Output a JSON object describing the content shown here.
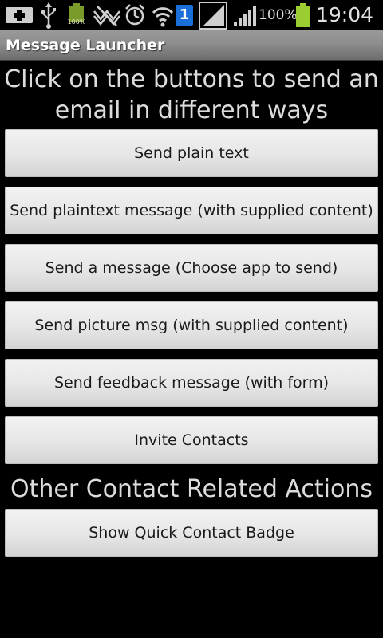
{
  "status_bar": {
    "icons": [
      "plus-icon",
      "usb-icon",
      "battery-full-icon",
      "no-signal-icon",
      "alarm-icon",
      "wifi-icon",
      "sim-slot-icon",
      "signal-strength-icon",
      "signal-strength-icon",
      "battery-icon"
    ],
    "small_battery_label": "100%",
    "sim_badge": "1",
    "battery_percent": "100%",
    "time": "19:04"
  },
  "title_bar": {
    "title": "Message Launcher"
  },
  "main": {
    "heading_line1": "Click on the buttons to send an",
    "heading_line2": "email in different ways",
    "buttons": [
      {
        "label": "Send plain text"
      },
      {
        "label": "Send plaintext message (with supplied content)"
      },
      {
        "label": "Send a message (Choose app to send)"
      },
      {
        "label": "Send picture msg (with supplied content)"
      },
      {
        "label": "Send feedback message (with form)"
      },
      {
        "label": "Invite Contacts"
      }
    ],
    "section_heading": "Other Contact Related Actions",
    "contact_buttons": [
      {
        "label": "Show Quick Contact Badge"
      }
    ]
  },
  "colors": {
    "background": "#000000",
    "title_bar": "#8d8d8d",
    "heading_text": "#dcdcdc",
    "button_face": "#e6e6e6",
    "battery_green": "#9acd32",
    "sim_badge": "#1a6fd8"
  }
}
